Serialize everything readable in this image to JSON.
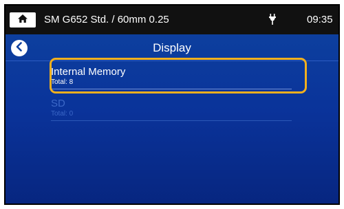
{
  "status_bar": {
    "title": "SM G652 Std. / 60mm 0.25",
    "time": "09:35",
    "home_icon": "home-icon",
    "power_icon": "plug-icon"
  },
  "header": {
    "title": "Display",
    "back_icon": "chevron-left-icon"
  },
  "memory_items": [
    {
      "name": "Internal Memory",
      "total": "Total: 8",
      "enabled": true
    },
    {
      "name": "SD",
      "total": "Total: 0",
      "enabled": false
    }
  ],
  "colors": {
    "screen_background": "#0a339a",
    "highlight": "#f2b01e",
    "status_bar": "#111111"
  }
}
